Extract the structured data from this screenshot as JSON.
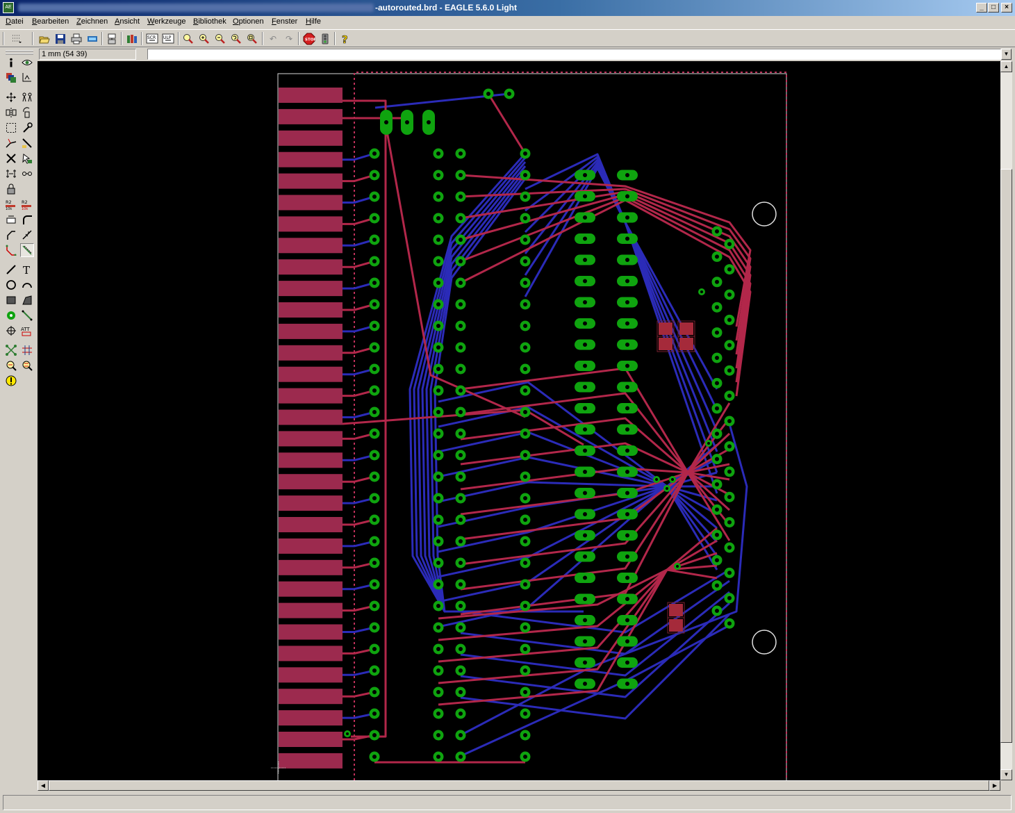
{
  "window": {
    "title": "-autorouted.brd - EAGLE 5.6.0 Light",
    "app_icon": "eagle-app-icon",
    "controls": [
      "minimize",
      "maximize",
      "close"
    ]
  },
  "menu": [
    {
      "label": "Datei"
    },
    {
      "label": "Bearbeiten"
    },
    {
      "label": "Zeichnen"
    },
    {
      "label": "Ansicht"
    },
    {
      "label": "Werkzeuge"
    },
    {
      "label": "Bibliothek"
    },
    {
      "label": "Optionen"
    },
    {
      "label": "Fenster"
    },
    {
      "label": "Hilfe"
    }
  ],
  "toolbar": {
    "buttons": [
      "grid-icon",
      "open-icon",
      "save-icon",
      "print-icon",
      "cam-icon",
      "board-schematic-icon",
      "library-icon",
      "script-icon",
      "ulp-icon",
      "zoom-fit-icon",
      "zoom-in-icon",
      "zoom-out-icon",
      "zoom-redraw-icon",
      "zoom-select-icon",
      "undo-icon",
      "redo-icon",
      "stop-icon",
      "go-icon",
      "help-icon"
    ]
  },
  "coordinates": {
    "value": "1 mm (54 39)"
  },
  "command_line": {
    "value": ""
  },
  "left_tools": [
    "info-icon",
    "show-icon",
    "display-icon",
    "mark-icon",
    "move-icon",
    "copy-icon",
    "mirror-icon",
    "rotate-icon",
    "group-icon",
    "change-icon",
    "split-icon",
    "optimize-icon",
    "delete-icon",
    "add-icon",
    "replace-icon",
    "pinswap-icon",
    "lock-icon",
    "name-icon",
    "value-icon",
    "smash-icon",
    "miter-icon",
    "route-icon",
    "ripup-icon",
    "wire-icon",
    "text-icon",
    "circle-icon",
    "arc-icon",
    "rect-icon",
    "polygon-icon",
    "via-icon",
    "signal-icon",
    "hole-icon",
    "attribute-icon",
    "ratsnest-icon",
    "auto-icon",
    "erc-icon",
    "drc-icon",
    "errors-icon"
  ],
  "colors": {
    "board_bg": "#000000",
    "top_layer": "#b2274a",
    "bottom_layer": "#2b2bb8",
    "pads": "#0fa30f",
    "pad_hole": "#000000",
    "contacts": "#9c2a4e",
    "outline": "#d8d8d8",
    "dim_line": "#c0305a"
  },
  "status": {
    "text": ""
  }
}
